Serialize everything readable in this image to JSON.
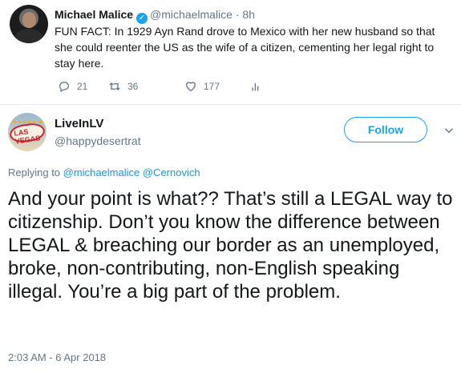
{
  "parent_tweet": {
    "name": "Michael Malice",
    "handle": "@michaelmalice",
    "dot": "·",
    "time": "8h",
    "verified_icon": "verified-badge-icon",
    "text": "FUN FACT: In 1929 Ayn Rand drove to Mexico with her new husband so that she could reenter the US as the wife of a citizen, cementing her legal right to stay here.",
    "actions": {
      "reply_count": "21",
      "retweet_count": "36",
      "like_count": "177"
    }
  },
  "reply_tweet": {
    "name": "LiveInLV",
    "handle": "@happydesertrat",
    "avatar_text": "LAS VEGAS",
    "follow_label": "Follow",
    "replying_prefix": "Replying to",
    "mention1": "@michaelmalice",
    "mention2": "@Cernovich",
    "text": "And your point is what?? That’s still a LEGAL way to citizenship. Don’t you know the difference between LEGAL & breaching our border as an unemployed, broke, non-contributing, non-English speaking illegal. You’re a big part of the problem.",
    "timestamp": "2:03 AM - 6 Apr 2018"
  },
  "colors": {
    "accent": "#1da1f2",
    "muted": "#657786",
    "text": "#14171a"
  }
}
